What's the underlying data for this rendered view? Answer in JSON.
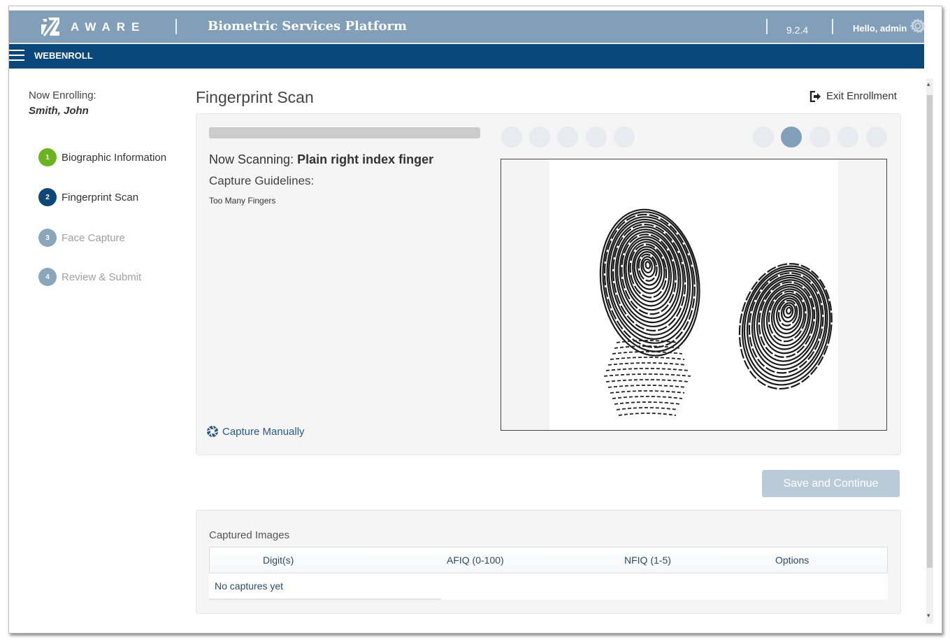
{
  "header": {
    "brand": "AWARE",
    "app_title": "Biometric Services Platform",
    "version": "9.2.4",
    "greeting": "Hello, admin",
    "colors": {
      "topbar": "#819fb8",
      "navbar": "#0a487b"
    }
  },
  "navbar": {
    "title": "WEBENROLL"
  },
  "sidebar": {
    "enrolling_label": "Now Enrolling:",
    "enrolling_name": "Smith, John",
    "steps": [
      {
        "num": "1",
        "label": "Biographic Information",
        "state": "complete",
        "color": "#6bb41e"
      },
      {
        "num": "2",
        "label": "Fingerprint Scan",
        "state": "current",
        "color": "#0f4776"
      },
      {
        "num": "3",
        "label": "Face Capture",
        "state": "pending",
        "color": "#8aa6bd"
      },
      {
        "num": "4",
        "label": "Review & Submit",
        "state": "pending",
        "color": "#8aa6bd"
      }
    ]
  },
  "main": {
    "page_title": "Fingerprint Scan",
    "exit_label": "Exit Enrollment",
    "scan": {
      "progress_percent": 100,
      "now_scanning_label": "Now Scanning: ",
      "now_scanning_value": "Plain right index finger",
      "guidelines_label": "Capture Guidelines:",
      "guidelines": [
        "Too Many Fingers"
      ],
      "capture_manually_label": "Capture Manually",
      "finger_dots": {
        "left_hand": [
          false,
          false,
          false,
          false,
          false
        ],
        "right_hand": [
          false,
          true,
          false,
          false,
          false
        ]
      },
      "image_alt": "fingerprint-preview"
    },
    "save_button_label": "Save and Continue",
    "captured": {
      "title": "Captured Images",
      "columns": [
        "Digit(s)",
        "AFIQ (0-100)",
        "NFIQ (1-5)",
        "Options"
      ],
      "empty_text": "No captures yet"
    }
  }
}
